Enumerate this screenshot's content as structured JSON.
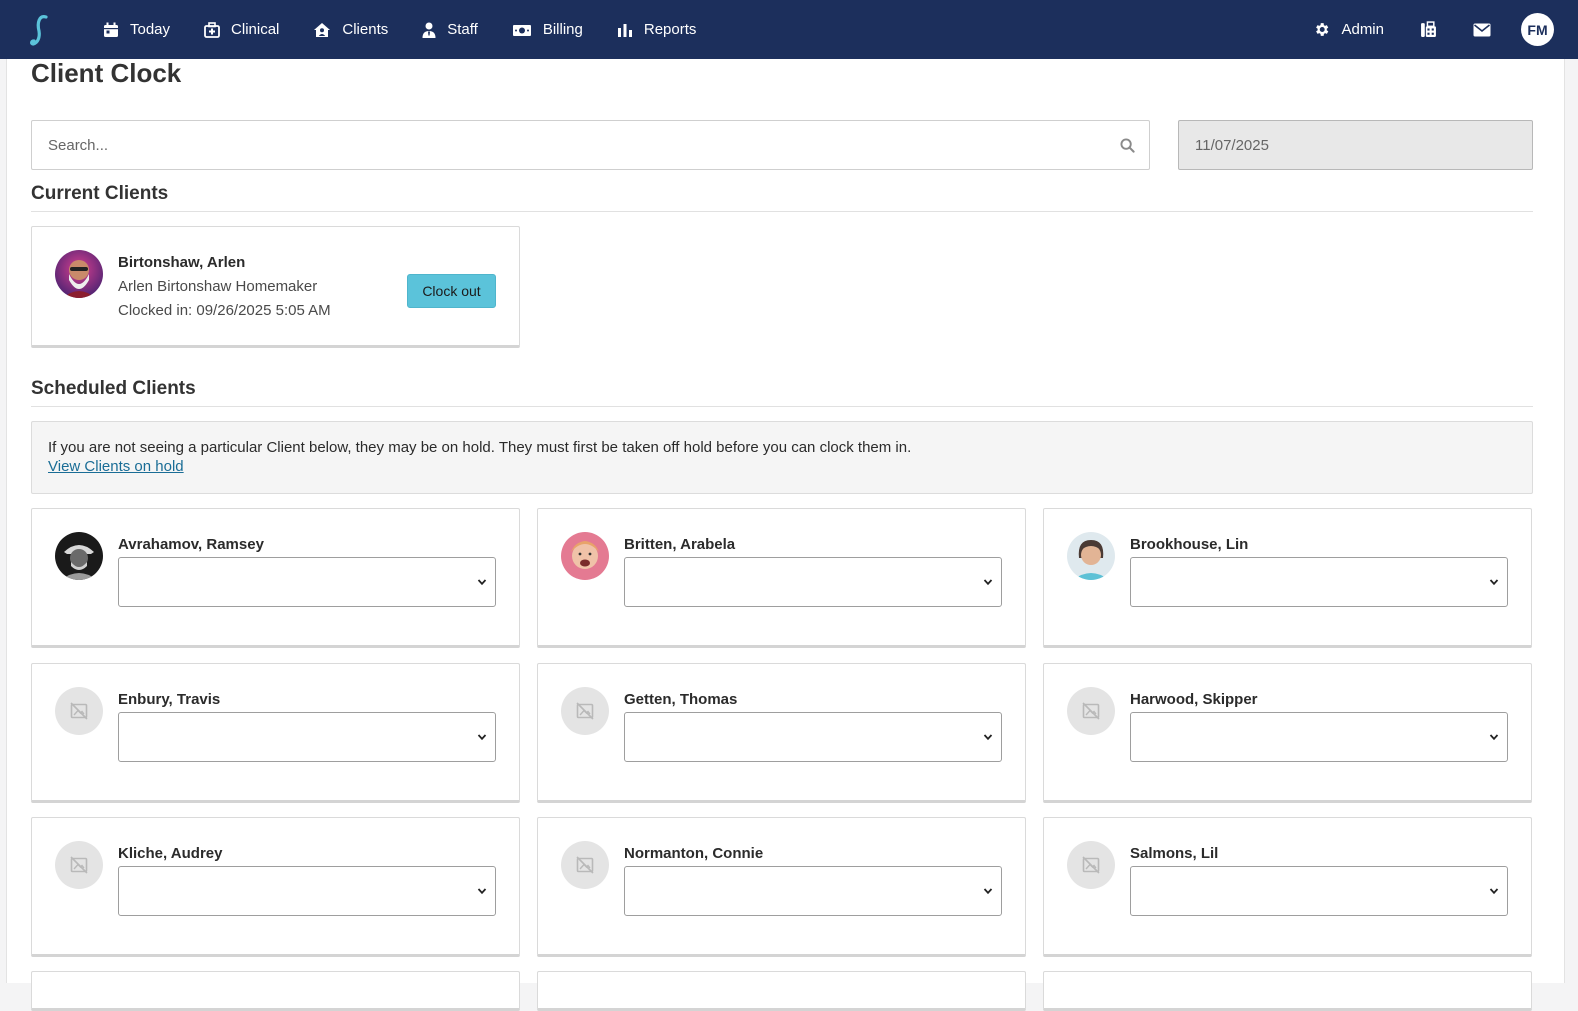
{
  "nav": {
    "items": [
      {
        "label": "Today",
        "icon": "calendar-icon"
      },
      {
        "label": "Clinical",
        "icon": "medical-bag-icon"
      },
      {
        "label": "Clients",
        "icon": "house-user-icon"
      },
      {
        "label": "Staff",
        "icon": "user-tie-icon"
      },
      {
        "label": "Billing",
        "icon": "money-icon"
      },
      {
        "label": "Reports",
        "icon": "bar-chart-icon"
      }
    ],
    "admin_label": "Admin",
    "user_initials": "FM",
    "brand_color": "#1c2f5c",
    "logo_color": "#5bc3da"
  },
  "page": {
    "title": "Client Clock",
    "search_placeholder": "Search...",
    "date_value": "11/07/2025"
  },
  "current_section": {
    "title": "Current Clients",
    "clients": [
      {
        "name": "Birtonshaw, Arlen",
        "service": "Arlen Birtonshaw Homemaker",
        "clocked_in": "Clocked in: 09/26/2025 5:05 AM",
        "button_label": "Clock out"
      }
    ]
  },
  "scheduled_section": {
    "title": "Scheduled Clients",
    "notice_text": "If you are not seeing a particular Client below, they may be on hold. They must first be taken off hold before you can clock them in.",
    "notice_link": "View Clients on hold",
    "clients": [
      {
        "name": "Avrahamov, Ramsey",
        "photo": "photo"
      },
      {
        "name": "Britten, Arabela",
        "photo": "photo"
      },
      {
        "name": "Brookhouse, Lin",
        "photo": "photo"
      },
      {
        "name": "Enbury, Travis",
        "photo": "placeholder"
      },
      {
        "name": "Getten, Thomas",
        "photo": "placeholder"
      },
      {
        "name": "Harwood, Skipper",
        "photo": "placeholder"
      },
      {
        "name": "Kliche, Audrey",
        "photo": "placeholder"
      },
      {
        "name": "Normanton, Connie",
        "photo": "placeholder"
      },
      {
        "name": "Salmons, Lil",
        "photo": "placeholder"
      }
    ]
  }
}
